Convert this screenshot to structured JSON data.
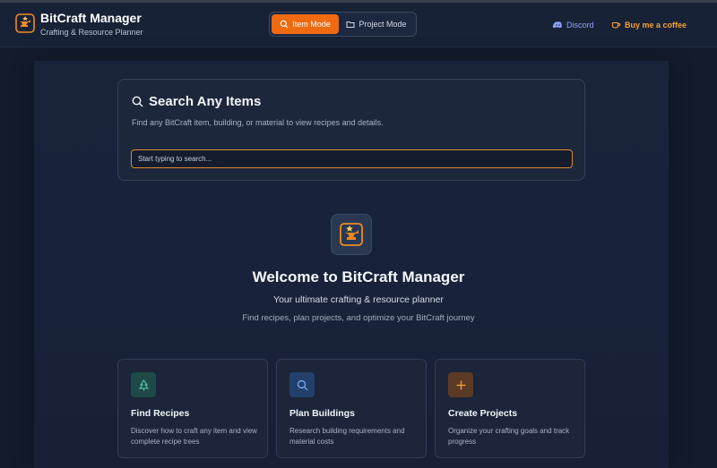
{
  "header": {
    "title": "BitCraft Manager",
    "subtitle": "Crafting & Resource Planner",
    "modes": [
      {
        "label": "Item Mode",
        "active": true
      },
      {
        "label": "Project Mode",
        "active": false
      }
    ],
    "links": {
      "discord": "Discord",
      "coffee": "Buy me a coffee"
    }
  },
  "search": {
    "title": "Search Any Items",
    "description": "Find any BitCraft item, building, or material to view recipes and details.",
    "placeholder": "Start typing to search..."
  },
  "hero": {
    "title": "Welcome to BitCraft Manager",
    "subtitle": "Your ultimate crafting & resource planner",
    "description": "Find recipes, plan projects, and optimize your BitCraft journey"
  },
  "features": [
    {
      "title": "Find Recipes",
      "description": "Discover how to craft any item and view complete recipe trees",
      "icon": "tree-icon"
    },
    {
      "title": "Plan Buildings",
      "description": "Research building requirements and material costs",
      "icon": "search-icon"
    },
    {
      "title": "Create Projects",
      "description": "Organize your crafting goals and track progress",
      "icon": "plus-icon"
    }
  ],
  "colors": {
    "accent": "#f06a12",
    "background": "#131b2c",
    "card": "#1d273b",
    "discord": "#8fa3ff",
    "coffee": "#f5a13a"
  }
}
